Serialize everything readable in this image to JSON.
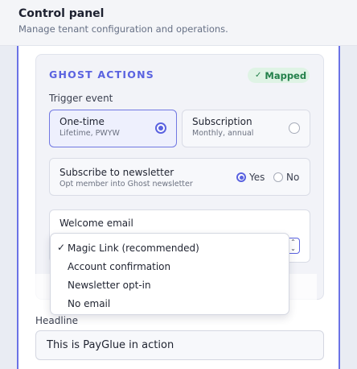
{
  "header": {
    "title": "Control panel",
    "subtitle": "Manage tenant configuration and operations."
  },
  "ghost_actions": {
    "title": "GHOST ACTIONS",
    "status_badge": "Mapped",
    "trigger_event": {
      "label": "Trigger event",
      "options": [
        {
          "title": "One-time",
          "subtitle": "Lifetime, PWYW",
          "selected": true
        },
        {
          "title": "Subscription",
          "subtitle": "Monthly, annual",
          "selected": false
        }
      ]
    },
    "newsletter": {
      "title": "Subscribe to newsletter",
      "subtitle": "Opt member into Ghost newsletter",
      "yes_label": "Yes",
      "no_label": "No",
      "value": "Yes"
    },
    "welcome_email": {
      "label": "Welcome email",
      "selected": "Magic Link (recommended)",
      "options": [
        "Magic Link (recommended)",
        "Account confirmation",
        "Newsletter opt-in",
        "No email"
      ]
    }
  },
  "headline": {
    "label": "Headline",
    "value": "This is PayGlue in action"
  },
  "colors": {
    "accent": "#5a62e0",
    "badge_bg": "#dff3e5",
    "badge_text": "#23804a"
  }
}
